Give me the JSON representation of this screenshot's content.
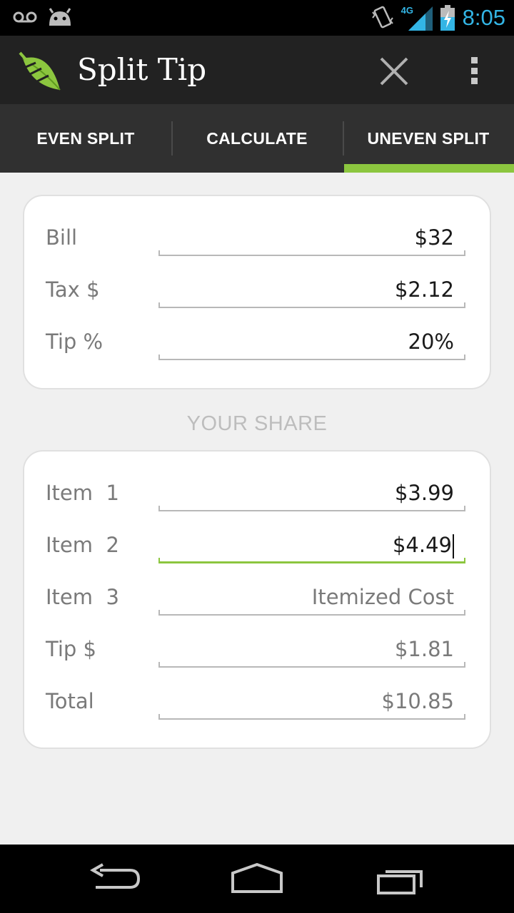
{
  "status_bar": {
    "time": "8:05",
    "network": "4G",
    "icons": [
      "voicemail-icon",
      "android-icon",
      "vibrate-icon",
      "signal-icon",
      "battery-charging-icon"
    ]
  },
  "action_bar": {
    "title": "Split Tip",
    "icons": [
      "leaf-logo-icon",
      "close-icon",
      "overflow-menu-icon"
    ]
  },
  "tabs": [
    {
      "label": "EVEN SPLIT",
      "active": false
    },
    {
      "label": "CALCULATE",
      "active": false
    },
    {
      "label": "UNEVEN SPLIT",
      "active": true
    }
  ],
  "bill_card": {
    "rows": [
      {
        "label": "Bill",
        "value": "$32"
      },
      {
        "label": "Tax $",
        "value": "$2.12"
      },
      {
        "label": "Tip %",
        "value": "20%"
      }
    ]
  },
  "share_section": {
    "title": "YOUR SHARE",
    "rows": [
      {
        "label": "Item  1",
        "value": "$3.99"
      },
      {
        "label": "Item  2",
        "value": "$4.49"
      },
      {
        "label": "Item  3",
        "value": "",
        "placeholder": "Itemized Cost"
      },
      {
        "label": "Tip $",
        "value": "$1.81"
      },
      {
        "label": "Total",
        "value": "$10.85"
      }
    ]
  },
  "nav_bar": {
    "icons": [
      "back-icon",
      "home-icon",
      "recent-apps-icon"
    ]
  },
  "colors": {
    "accent": "#8cc63f",
    "status_blue": "#33b5e5",
    "action_bar": "#222222",
    "tab_bar": "#303030",
    "background": "#f0f0f0"
  }
}
